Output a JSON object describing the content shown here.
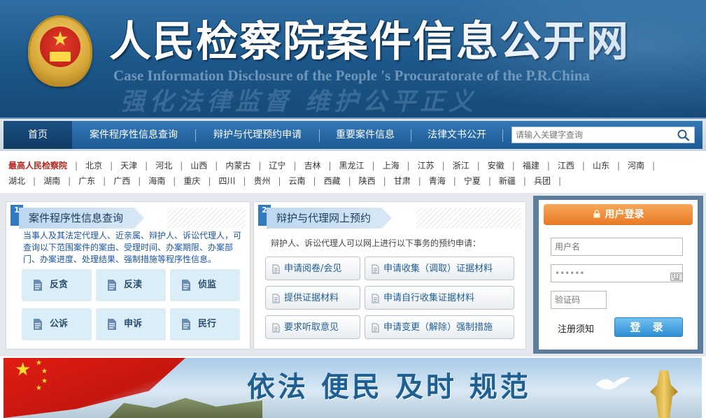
{
  "header": {
    "title_cn": "人民检察院案件信息公开网",
    "title_en": "Case Information Disclosure of the People 's Procuratorate of the P.R.China",
    "slogan": "强化法律监督 维护公平正义"
  },
  "nav": {
    "items": [
      {
        "label": "首页",
        "active": true
      },
      {
        "label": "案件程序性信息查询",
        "active": false
      },
      {
        "label": "辩护与代理预约申请",
        "active": false
      },
      {
        "label": "重要案件信息",
        "active": false
      },
      {
        "label": "法律文书公开",
        "active": false
      }
    ],
    "search_placeholder": "请输入关键字查询",
    "search_icon": "magnifier-icon"
  },
  "regions": {
    "row1": [
      "最高人民检察院",
      "北京",
      "天津",
      "河北",
      "山西",
      "内蒙古",
      "辽宁",
      "吉林",
      "黑龙江",
      "上海",
      "江苏",
      "浙江",
      "安徽",
      "福建",
      "江西",
      "山东",
      "河南"
    ],
    "row2": [
      "湖北",
      "湖南",
      "广东",
      "广西",
      "海南",
      "重庆",
      "四川",
      "贵州",
      "云南",
      "西藏",
      "陕西",
      "甘肃",
      "青海",
      "宁夏",
      "新疆",
      "兵团"
    ]
  },
  "panel1": {
    "number": "1",
    "title": "案件程序性信息查询",
    "description": "当事人及其法定代理人、近亲属、辩护人、诉讼代理人，可查询以下范围案件的案由、受理时间、办案期限、办案部门、办案进度、处理结果、强制措施等程序性信息。",
    "tiles": [
      "反贪",
      "反渎",
      "侦监",
      "公诉",
      "申诉",
      "民行"
    ]
  },
  "panel2": {
    "number": "2",
    "title": "辩护与代理网上预约",
    "description": "辩护人、诉讼代理人可以网上进行以下事务的预约申请：",
    "buttons": [
      "申请阅卷/会见",
      "申请收集（调取）证据材料",
      "提供证据材料",
      "申请自行收集证据材料",
      "要求听取意见",
      "申请变更（解除）强制措施"
    ]
  },
  "login": {
    "title": "用户登录",
    "username_placeholder": "用户名",
    "password_value": "••••••",
    "captcha_placeholder": "验证码",
    "register_link": "注册须知",
    "login_button": "登 录"
  },
  "banner": {
    "text": "依法  便民  及时  规范"
  },
  "colors": {
    "header_blue": "#1c5688",
    "nav_blue": "#1c5a95",
    "accent_red": "#b3261e",
    "login_orange": "#e77a25",
    "login_button_blue": "#2f8fd3"
  }
}
